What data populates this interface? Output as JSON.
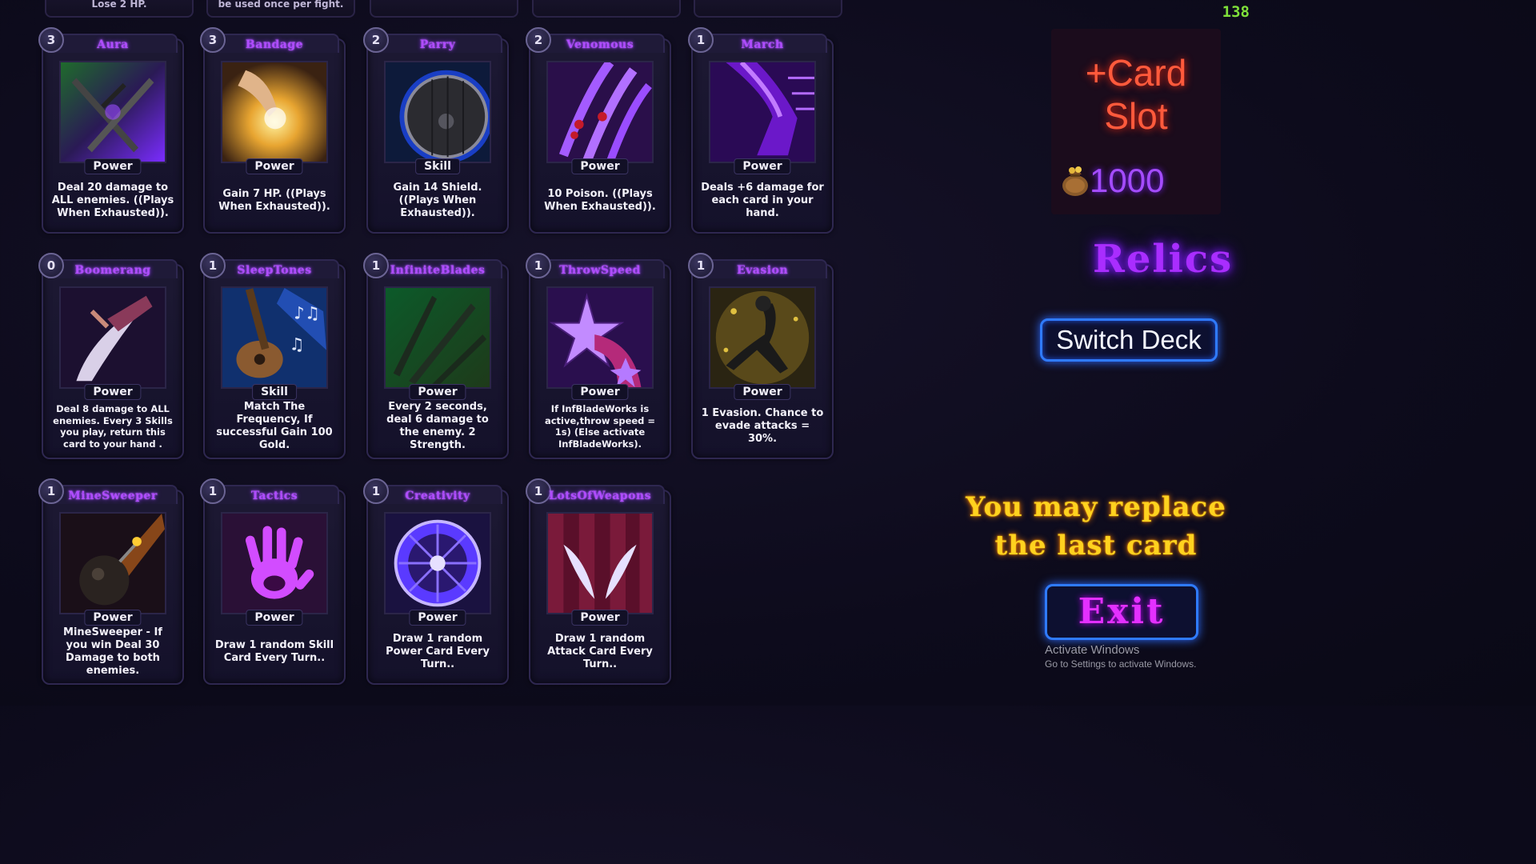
{
  "fps": "138",
  "ghost_row": [
    "Lose 2 HP.",
    "be used once per fight.",
    "",
    "",
    ""
  ],
  "cards": [
    {
      "cost": "3",
      "title": "Aura",
      "art": "daggers-icon",
      "type": "Power",
      "desc": "Deal 20 damage to ALL enemies. ((Plays When Exhausted))."
    },
    {
      "cost": "3",
      "title": "Bandage",
      "art": "healing-hand-icon",
      "type": "Power",
      "desc": "Gain 7 HP. ((Plays When Exhausted))."
    },
    {
      "cost": "2",
      "title": "Parry",
      "art": "shield-icon",
      "type": "Skill",
      "desc": "Gain 14 Shield. ((Plays When Exhausted))."
    },
    {
      "cost": "2",
      "title": "Venomous",
      "art": "venom-claws-icon",
      "type": "Power",
      "desc": "10 Poison. ((Plays When Exhausted))."
    },
    {
      "cost": "1",
      "title": "March",
      "art": "marching-leg-icon",
      "type": "Power",
      "desc": "Deals +6 damage for each card in your hand."
    },
    {
      "cost": "0",
      "title": "Boomerang",
      "art": "boomerang-icon",
      "type": "Power",
      "desc": "Deal 8 damage to ALL enemies. Every 3 Skills you play, return this card to your hand .",
      "small": true
    },
    {
      "cost": "1",
      "title": "SleepTones",
      "art": "guitar-icon",
      "type": "Skill",
      "desc": "Match The Frequency, If successful Gain 100 Gold."
    },
    {
      "cost": "1",
      "title": "InfiniteBlades",
      "art": "blades-icon",
      "type": "Power",
      "desc": "Every 2 seconds, deal 6 damage to the enemy.  2 Strength."
    },
    {
      "cost": "1",
      "title": "ThrowSpeed",
      "art": "shuriken-icon",
      "type": "Power",
      "desc": "If InfBladeWorks is active,throw speed = 1s) (Else activate InfBladeWorks).",
      "small": true
    },
    {
      "cost": "1",
      "title": "Evasion",
      "art": "evasion-figure-icon",
      "type": "Power",
      "desc": "1 Evasion. Chance to evade attacks = 30%."
    },
    {
      "cost": "1",
      "title": "MineSweeper",
      "art": "bomb-icon",
      "type": "Power",
      "desc": "MineSweeper - If you win Deal 30 Damage to both enemies."
    },
    {
      "cost": "1",
      "title": "Tactics",
      "art": "handprint-icon",
      "type": "Power",
      "desc": "Draw 1 random Skill Card Every Turn.."
    },
    {
      "cost": "1",
      "title": "Creativity",
      "art": "vortex-icon",
      "type": "Power",
      "desc": "Draw 1 random Power Card Every Turn.."
    },
    {
      "cost": "1",
      "title": "LotsOfWeapons",
      "art": "curtain-eyes-icon",
      "type": "Power",
      "desc": "Draw 1 random Attack Card Every Turn.."
    }
  ],
  "shop": {
    "title_line1": "+Card",
    "title_line2": "Slot",
    "price": "1000",
    "icon": "coin-bag-icon"
  },
  "relics_label": "Relics",
  "switch_deck_label": "Switch Deck",
  "hint_line1": "You may replace",
  "hint_line2": "the last card",
  "exit_label": "Exit",
  "watermark": {
    "title": "Activate Windows",
    "subtitle": "Go to Settings to activate Windows."
  },
  "colors": {
    "accent": "#b04cff",
    "button_border": "#2f7bff",
    "hint": "#ffd21f",
    "shop_title": "#ff5a3c",
    "fps": "#7fe03a"
  }
}
